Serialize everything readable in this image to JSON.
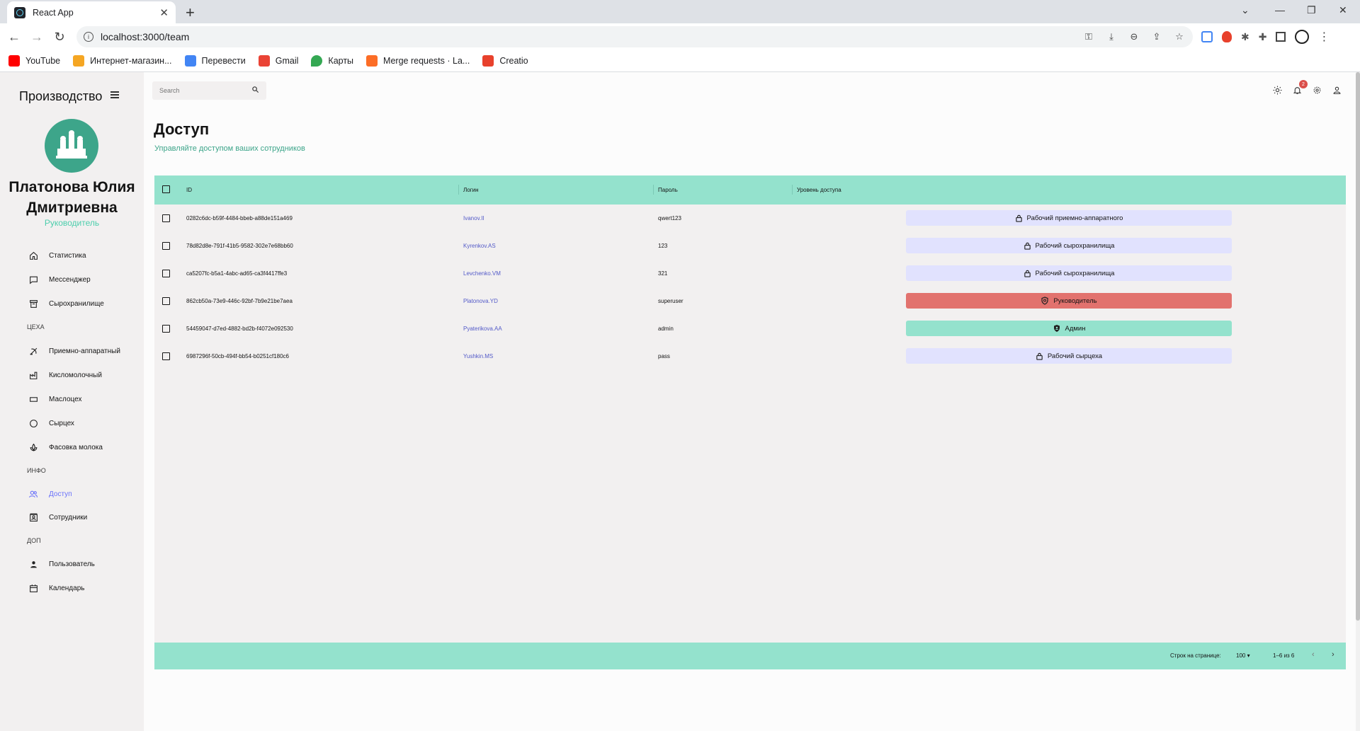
{
  "browser": {
    "tab_title": "React App",
    "url": "localhost:3000/team",
    "bookmarks": [
      {
        "label": "YouTube",
        "color": "#ff0000"
      },
      {
        "label": "Интернет-магазин...",
        "color": "#f5a623"
      },
      {
        "label": "Перевести",
        "color": "#4285f4"
      },
      {
        "label": "Gmail",
        "color": "#ea4335"
      },
      {
        "label": "Карты",
        "color": "#34a853"
      },
      {
        "label": "Merge requests · La...",
        "color": "#fc6d26"
      },
      {
        "label": "Creatio",
        "color": "#e8412c"
      }
    ]
  },
  "sidebar": {
    "brand": "Производство",
    "user_name": "Платонова Юлия Дмитриевна",
    "user_role": "Руководитель",
    "items": [
      {
        "label": "Статистика",
        "icon": "home-icon"
      },
      {
        "label": "Мессенджер",
        "icon": "chat-icon"
      },
      {
        "label": "Сырохранилище",
        "icon": "archive-icon"
      }
    ],
    "section_shops": "ЦЕХА",
    "shops": [
      {
        "label": "Приемно-аппаратный",
        "icon": "satellite-icon"
      },
      {
        "label": "Кисломолочный",
        "icon": "factory-icon"
      },
      {
        "label": "Маслоцех",
        "icon": "box-icon"
      },
      {
        "label": "Сырцех",
        "icon": "circle-icon"
      },
      {
        "label": "Фасовка молока",
        "icon": "spa-icon"
      }
    ],
    "section_info": "ИНФО",
    "info": [
      {
        "label": "Доступ",
        "icon": "people-icon"
      },
      {
        "label": "Сотрудники",
        "icon": "contacts-icon"
      }
    ],
    "section_extra": "ДОП",
    "extra": [
      {
        "label": "Пользователь",
        "icon": "person-icon"
      },
      {
        "label": "Календарь",
        "icon": "calendar-icon"
      }
    ]
  },
  "topbar": {
    "search_placeholder": "Search",
    "notifications_count": "2"
  },
  "page": {
    "title": "Доступ",
    "subtitle": "Управляйте доступом ваших сотрудников"
  },
  "table": {
    "columns": {
      "id": "ID",
      "login": "Логин",
      "password": "Пароль",
      "access": "Уровень доступа"
    },
    "rows": [
      {
        "id": "0282c6dc-b59f-4484-bbeb-a88de151a469",
        "login": "Ivanov.II",
        "password": "qwert123",
        "access": "Рабочий приемно-аппаратного",
        "level": "worker"
      },
      {
        "id": "78d82d8e-791f-41b5-9582-302e7e68bb60",
        "login": "Kyrenkov.AS",
        "password": "123",
        "access": "Рабочий сырохранилища",
        "level": "worker"
      },
      {
        "id": "ca5207fc-b5a1-4abc-ad65-ca3f4417ffe3",
        "login": "Levchenko.VM",
        "password": "321",
        "access": "Рабочий сырохранилища",
        "level": "worker"
      },
      {
        "id": "862cb50a-73e9-446c-92bf-7b9e21be7aea",
        "login": "Platonova.YD",
        "password": "superuser",
        "access": "Руководитель",
        "level": "manager"
      },
      {
        "id": "54459047-d7ed-4882-bd2b-f4072e092530",
        "login": "Pyaterikova.AA",
        "password": "admin",
        "access": "Админ",
        "level": "admin"
      },
      {
        "id": "6987296f-50cb-494f-bb54-b0251cf180c6",
        "login": "Yushkin.MS",
        "password": "pass",
        "access": "Рабочий сырцеха",
        "level": "worker"
      }
    ],
    "footer": {
      "rows_per_page_label": "Строк на странице:",
      "rows_per_page_value": "100",
      "range": "1–6 из 6"
    }
  },
  "colors": {
    "accent_green": "#94e2cd",
    "accent_blue": "#6870fa",
    "manager_red": "#e2726e",
    "worker_lavender": "#e1e2fe"
  }
}
